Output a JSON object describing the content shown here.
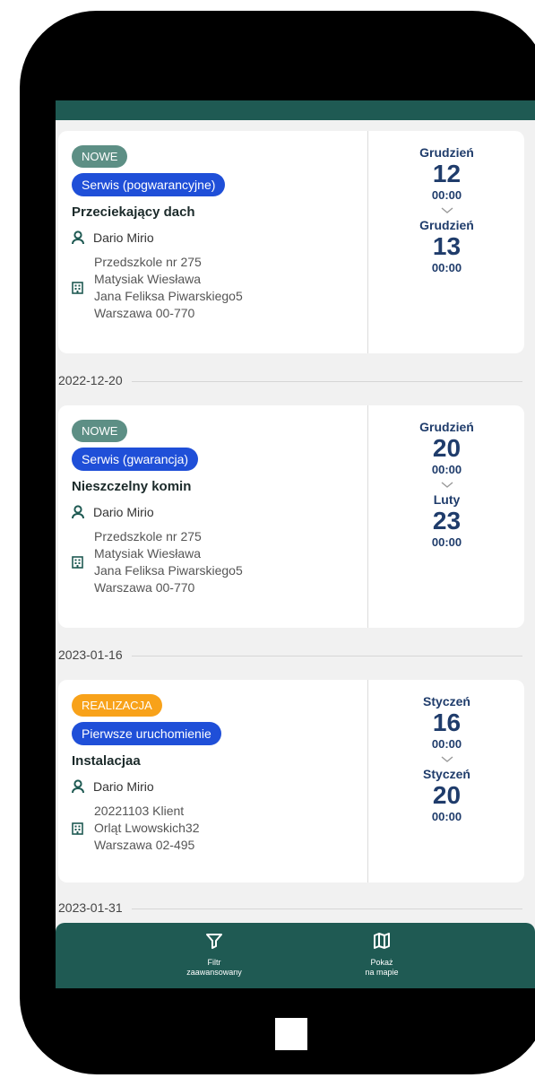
{
  "orders": [
    {
      "status": "NOWE",
      "type": "Serwis (pogwarancyjne)",
      "title": "Przeciekający dach",
      "person": "Dario Mirio",
      "address": [
        "Przedszkole nr 275",
        "Matysiak Wiesława",
        "Jana Feliksa Piwarskiego5",
        "Warszawa 00-770"
      ],
      "start": {
        "month": "Grudzień",
        "day": "12",
        "time": "00:00"
      },
      "end": {
        "month": "Grudzień",
        "day": "13",
        "time": "00:00"
      }
    },
    {
      "status": "NOWE",
      "type": "Serwis (gwarancja)",
      "title": "Nieszczelny komin",
      "person": "Dario Mirio",
      "address": [
        "Przedszkole nr 275",
        "Matysiak Wiesława",
        "Jana Feliksa Piwarskiego5",
        "Warszawa 00-770"
      ],
      "start": {
        "month": "Grudzień",
        "day": "20",
        "time": "00:00"
      },
      "end": {
        "month": "Luty",
        "day": "23",
        "time": "00:00"
      }
    },
    {
      "status": "REALIZACJA",
      "type": "Pierwsze uruchomienie",
      "title": "Instalacjaa",
      "person": "Dario Mirio",
      "address": [
        "20221103 Klient",
        "Orląt Lwowskich32",
        "Warszawa 02-495"
      ],
      "start": {
        "month": "Styczeń",
        "day": "16",
        "time": "00:00"
      },
      "end": {
        "month": "Styczeń",
        "day": "20",
        "time": "00:00"
      }
    }
  ],
  "date_separators": [
    "2022-12-20",
    "2023-01-16",
    "2023-01-31"
  ],
  "bottom_nav": {
    "filter_label_1": "Filtr",
    "filter_label_2": "zaawansowany",
    "map_label_1": "Pokaż",
    "map_label_2": "na mapie"
  },
  "colors": {
    "brand": "#1f5a53",
    "status_new": "#5d8f85",
    "status_in_progress": "#f8a21a",
    "type_badge": "#1f4fd8",
    "date_text": "#1f3c6b"
  }
}
